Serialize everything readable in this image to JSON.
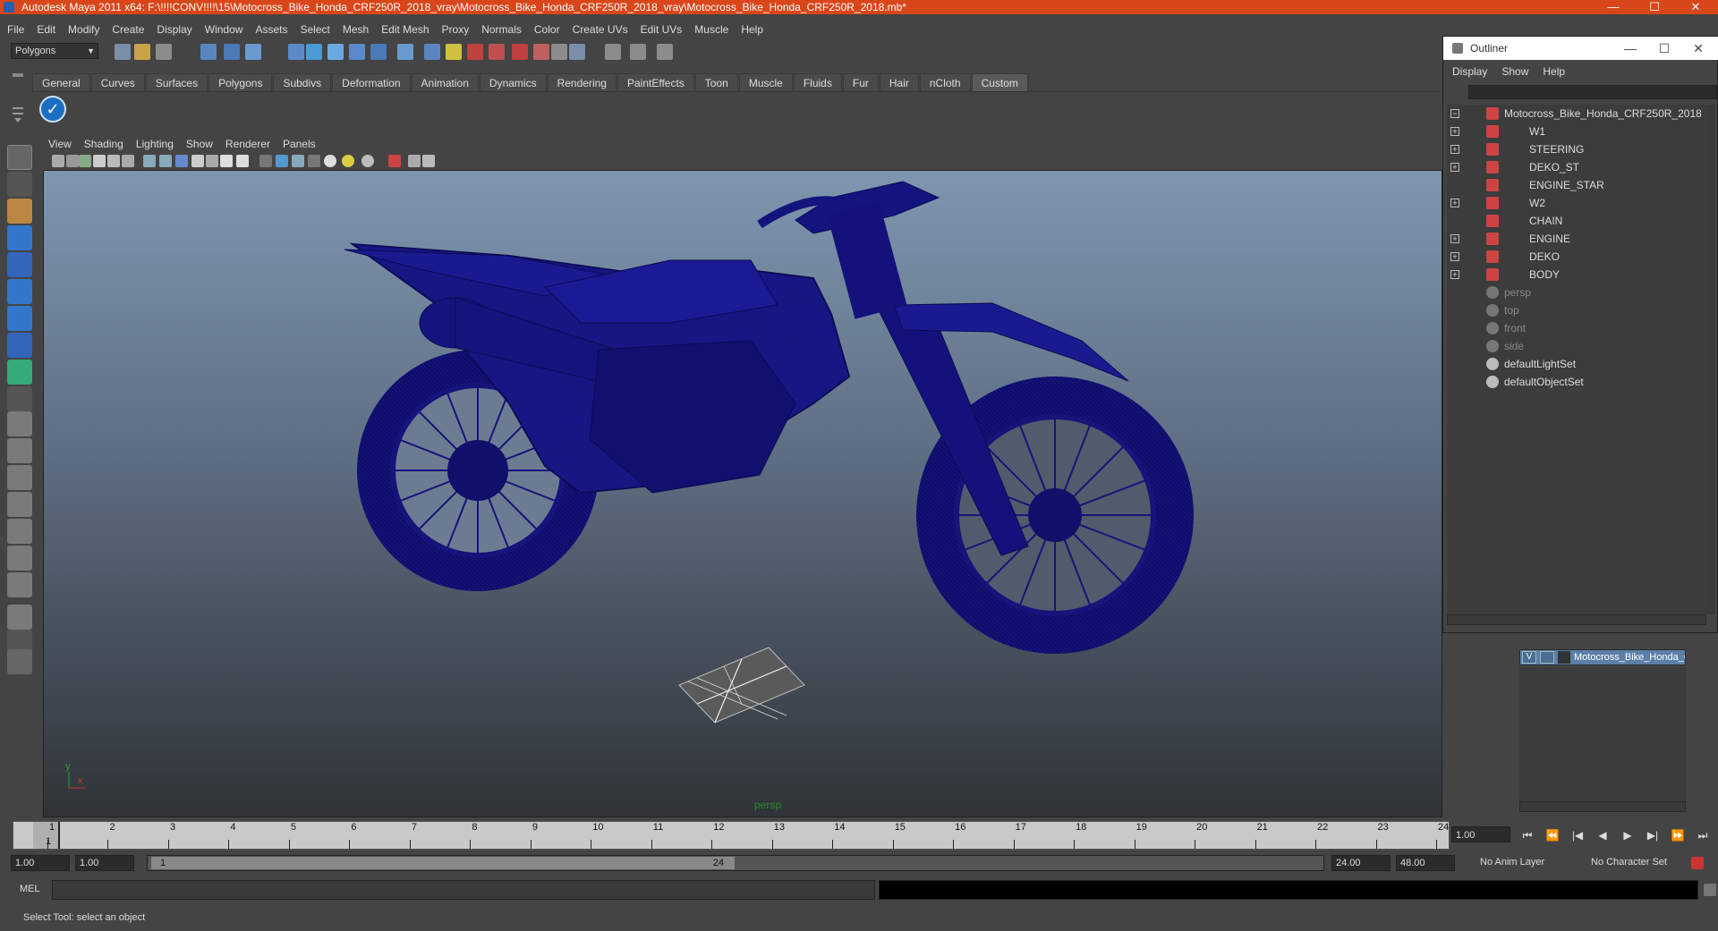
{
  "window": {
    "title": "Autodesk Maya 2011 x64: F:\\!!!!CONV!!!!\\15\\Motocross_Bike_Honda_CRF250R_2018_vray\\Motocross_Bike_Honda_CRF250R_2018_vray\\Motocross_Bike_Honda_CRF250R_2018.mb*",
    "minimize": "—",
    "maximize": "☐",
    "close": "✕"
  },
  "menubar": [
    "File",
    "Edit",
    "Modify",
    "Create",
    "Display",
    "Window",
    "Assets",
    "Select",
    "Mesh",
    "Edit Mesh",
    "Proxy",
    "Normals",
    "Color",
    "Create UVs",
    "Edit UVs",
    "Muscle",
    "Help"
  ],
  "statusline": {
    "mode": "Polygons"
  },
  "shelf": {
    "tabs": [
      "General",
      "Curves",
      "Surfaces",
      "Polygons",
      "Subdivs",
      "Deformation",
      "Animation",
      "Dynamics",
      "Rendering",
      "PaintEffects",
      "Toon",
      "Muscle",
      "Fluids",
      "Fur",
      "Hair",
      "nCloth",
      "Custom"
    ],
    "active_tab": "Custom",
    "check_icon": "✓"
  },
  "panel": {
    "menu": [
      "View",
      "Shading",
      "Lighting",
      "Show",
      "Renderer",
      "Panels"
    ],
    "camera_label": "persp",
    "axis_y": "y",
    "axis_x": "x",
    "accent_color": "#2a2a8a"
  },
  "outliner": {
    "title": "Outliner",
    "menu": [
      "Display",
      "Show",
      "Help"
    ],
    "items": [
      {
        "label": "Motocross_Bike_Honda_CRF250R_2018",
        "expander": "−",
        "depth": 0,
        "dim": false
      },
      {
        "label": "W1",
        "expander": "+",
        "depth": 1,
        "dim": false
      },
      {
        "label": "STEERING",
        "expander": "+",
        "depth": 1,
        "dim": false
      },
      {
        "label": "DEKO_ST",
        "expander": "+",
        "depth": 1,
        "dim": false
      },
      {
        "label": "ENGINE_STAR",
        "expander": "",
        "depth": 1,
        "dim": false
      },
      {
        "label": "W2",
        "expander": "+",
        "depth": 1,
        "dim": false
      },
      {
        "label": "CHAIN",
        "expander": "",
        "depth": 1,
        "dim": false
      },
      {
        "label": "ENGINE",
        "expander": "+",
        "depth": 1,
        "dim": false
      },
      {
        "label": "DEKO",
        "expander": "+",
        "depth": 1,
        "dim": false
      },
      {
        "label": "BODY",
        "expander": "+",
        "depth": 1,
        "dim": false
      },
      {
        "label": "persp",
        "expander": "",
        "depth": 0,
        "dim": true
      },
      {
        "label": "top",
        "expander": "",
        "depth": 0,
        "dim": true
      },
      {
        "label": "front",
        "expander": "",
        "depth": 0,
        "dim": true
      },
      {
        "label": "side",
        "expander": "",
        "depth": 0,
        "dim": true
      },
      {
        "label": "defaultLightSet",
        "expander": "",
        "depth": 0,
        "dim": false
      },
      {
        "label": "defaultObjectSet",
        "expander": "",
        "depth": 0,
        "dim": false
      }
    ]
  },
  "layers": {
    "visible_flag": "V",
    "layer_name": "Motocross_Bike_Honda_C"
  },
  "timeline": {
    "ticks": [
      "1",
      "2",
      "3",
      "4",
      "5",
      "6",
      "7",
      "8",
      "9",
      "10",
      "11",
      "12",
      "13",
      "14",
      "15",
      "16",
      "17",
      "18",
      "19",
      "20",
      "21",
      "22",
      "23",
      "24"
    ],
    "current_frame": "1",
    "current_frame_field": "1.00",
    "playback": [
      "⏮",
      "⏪",
      "|◀",
      "◀",
      "▶",
      "▶|",
      "⏩",
      "⏭"
    ]
  },
  "range": {
    "start_time": "1.00",
    "playback_start": "1.00",
    "handle_start": "1",
    "handle_end": "24",
    "playback_end": "24.00",
    "end_time": "48.00",
    "anim_layer": "No Anim Layer",
    "character_set": "No Character Set"
  },
  "commandline": {
    "label": "MEL"
  },
  "helpline": {
    "text": "Select Tool: select an object"
  }
}
